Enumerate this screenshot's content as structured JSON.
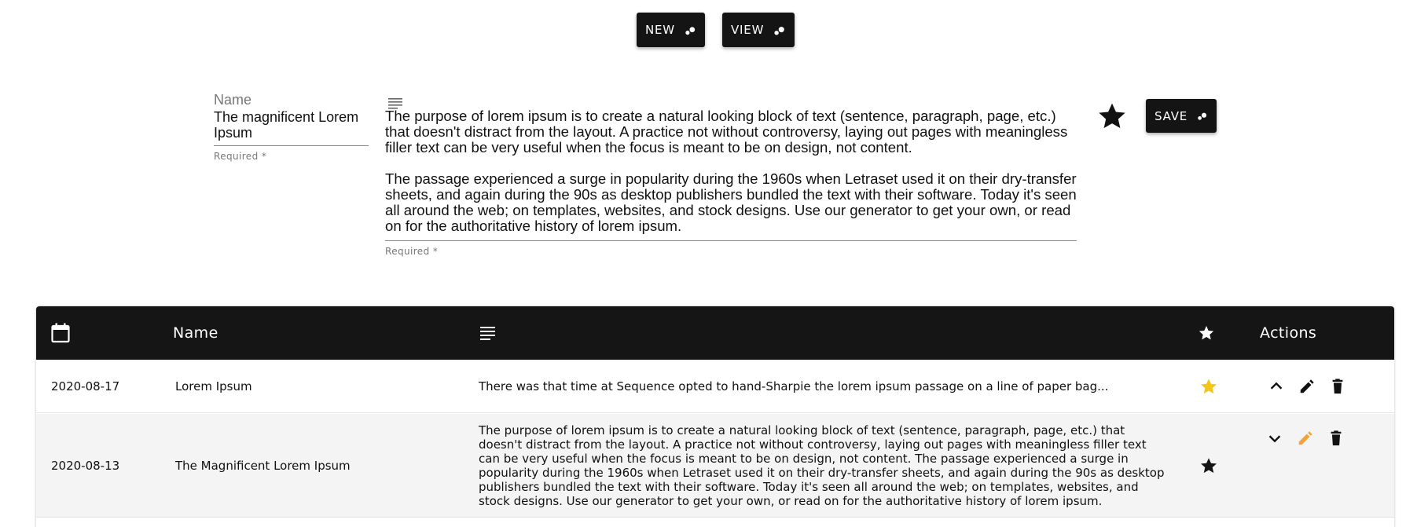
{
  "toolbar": {
    "new_label": "NEW",
    "view_label": "VIEW"
  },
  "form": {
    "name_label": "Name",
    "name_value": "The magnificent Lorem Ipsum",
    "name_helper": "Required *",
    "description_paragraph_1": "The purpose of lorem ipsum is to create a natural looking block of text (sentence, paragraph, page, etc.) that doesn't distract from the layout. A practice not without controversy, laying out pages with meaningless filler text can be very useful when the focus is meant to be on design, not content.",
    "description_paragraph_2": "The passage experienced a surge in popularity during the 1960s when Letraset used it on their dry-transfer sheets, and again during the 90s as desktop publishers bundled the text with their software. Today it's seen all around the web; on templates, websites, and stock designs. Use our generator to get your own, or read on for the authoritative history of lorem ipsum.",
    "description_helper": "Required *",
    "favorite": true,
    "save_label": "SAVE"
  },
  "table": {
    "columns": {
      "date_icon": "calendar-icon",
      "name": "Name",
      "description_icon": "notes-icon",
      "favorite_icon": "star-icon",
      "actions": "Actions"
    },
    "rows": [
      {
        "date": "2020-08-17",
        "name": "Lorem Ipsum",
        "description": "There was that time at Sequence opted to hand-Sharpie the lorem ipsum passage on a line of paper bag...",
        "favorite": true,
        "favorite_color": "#f5c518",
        "expanded": true
      },
      {
        "date": "2020-08-13",
        "name": "The Magnificent Lorem Ipsum",
        "description": "The purpose of lorem ipsum is to create a natural looking block of text (sentence, paragraph, page, etc.) that doesn't distract from the layout. A practice not without controversy, laying out pages with meaningless filler text can be very useful when the focus is meant to be on design, not content. The passage experienced a surge in popularity during the 1960s when Letraset used it on their dry-transfer sheets, and again during the 90s as desktop publishers bundled the text with their software. Today it's seen all around the web; on templates, websites, and stock designs. Use our generator to get your own, or read on for the authoritative history of lorem ipsum.",
        "favorite": true,
        "favorite_color": "#141414",
        "editing": true,
        "edit_color": "#f5a13a"
      }
    ]
  }
}
